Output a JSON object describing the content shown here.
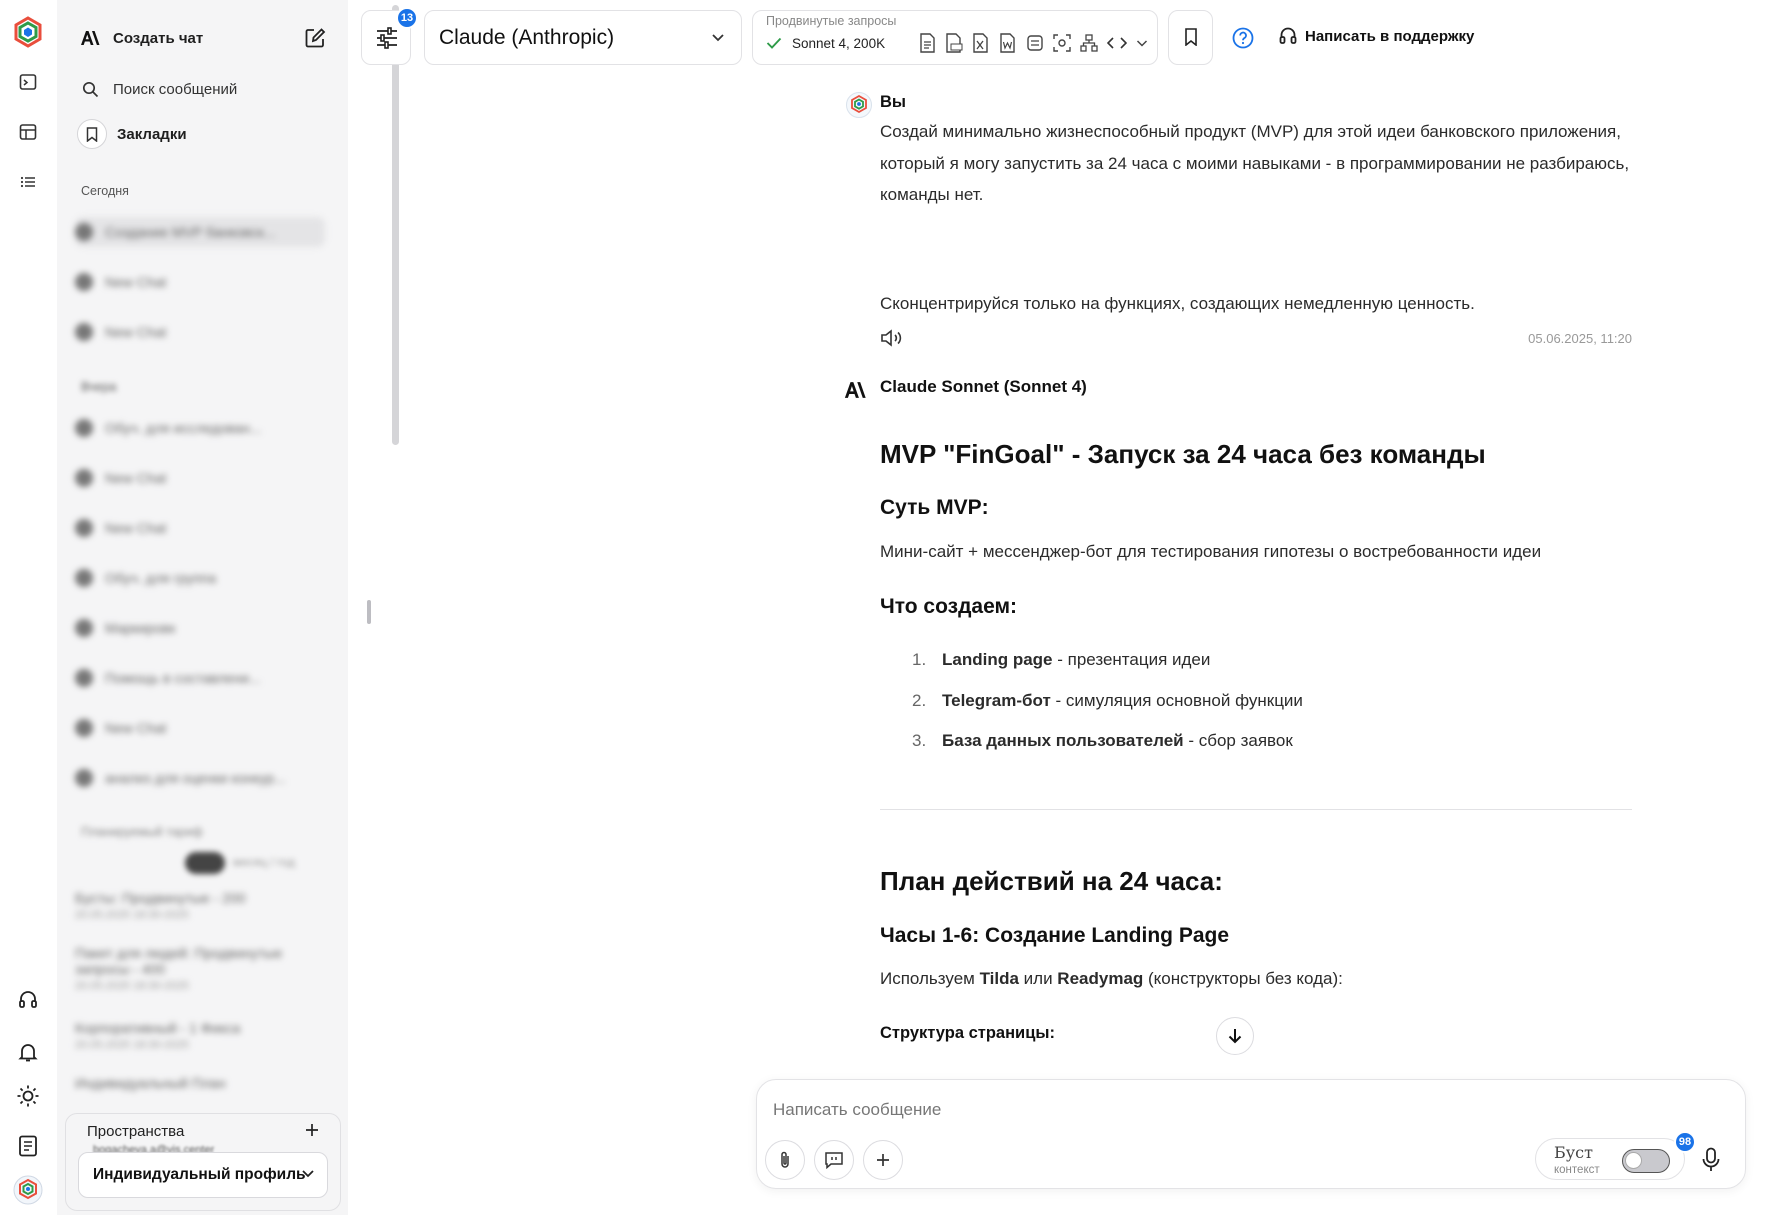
{
  "sidebar": {
    "create_chat": "Создать чат",
    "search": "Поиск сообщений",
    "bookmarks": "Закладки",
    "section_today": "Сегодня",
    "section_earlier": "Вчера",
    "chats": [
      "Создание MVP банковск...",
      "New Chat",
      "New Chat",
      "Обуч. для исследован...",
      "New Chat",
      "New Chat",
      "Обуч. для группа",
      "Маркировк",
      "Помощь в составлени...",
      "New Chat",
      "анализ для оценки конкур..."
    ],
    "plan_section": "Планируемый тариф",
    "plan_toggle_label": "месяц / год",
    "plans": [
      {
        "name": "Бусты: Продвинутые - 200",
        "date": "20.05.2025 18:30-2025"
      },
      {
        "name": "Пакет для людей: Продвинутые запросы - 400",
        "date": "20.05.2025 18:30-2025"
      },
      {
        "name": "Корпоративный - 1 Фикса",
        "date": "20.05.2025 18:30-2025"
      },
      {
        "name": "Индивидуальный План",
        "date": ""
      }
    ],
    "spaces_title": "Пространства",
    "spaces_email": "bogacheva.a@vis.center",
    "profile": "Индивидуальный профиль"
  },
  "toolbar": {
    "settings_badge": "13",
    "model": "Claude (Anthropic)",
    "advanced_label": "Продвинутые запросы",
    "advanced_value": "Sonnet 4, 200K",
    "support": "Написать в поддержку"
  },
  "chat": {
    "user_name": "Вы",
    "user_text": "Создай минимально жизнеспособный продукт (MVP) для этой идеи банковского приложения, который я могу запустить за 24 часа с моими навыками - в программировании не разбираюсь, команды нет.",
    "user_text2": "Сконцентрируйся только на функциях, создающих немедленную ценность.",
    "timestamp": "05.06.2025, 11:20",
    "assistant_name": "Claude Sonnet (Sonnet 4)",
    "h1": "MVP \"FinGoal\" - Запуск за 24 часа без команды",
    "essence_title": "Суть MVP:",
    "essence_text": "Мини-сайт + мессенджер-бот для тестирования гипотезы о востребованности идеи",
    "create_title": "Что создаем:",
    "list": [
      {
        "num": "1.",
        "bold": "Landing page",
        "rest": " - презентация идеи"
      },
      {
        "num": "2.",
        "bold": "Telegram-бот",
        "rest": " - симуляция основной функции"
      },
      {
        "num": "3.",
        "bold": "База данных пользователей",
        "rest": " - сбор заявок"
      }
    ],
    "plan_title": "План действий на 24 часа:",
    "hours_title": "Часы 1-6: Создание Landing Page",
    "use_prefix": "Используем ",
    "tool1": "Tilda",
    "use_or": " или ",
    "tool2": "Readymag",
    "use_suffix": " (конструкторы без кода):",
    "structure_title": "Структура страницы:"
  },
  "composer": {
    "placeholder": "Написать сообщение",
    "boost_label": "Буст",
    "boost_sub": "контекст",
    "boost_badge": "98"
  },
  "colors": {
    "accent": "#1a73e8",
    "check": "#2e9b48"
  }
}
